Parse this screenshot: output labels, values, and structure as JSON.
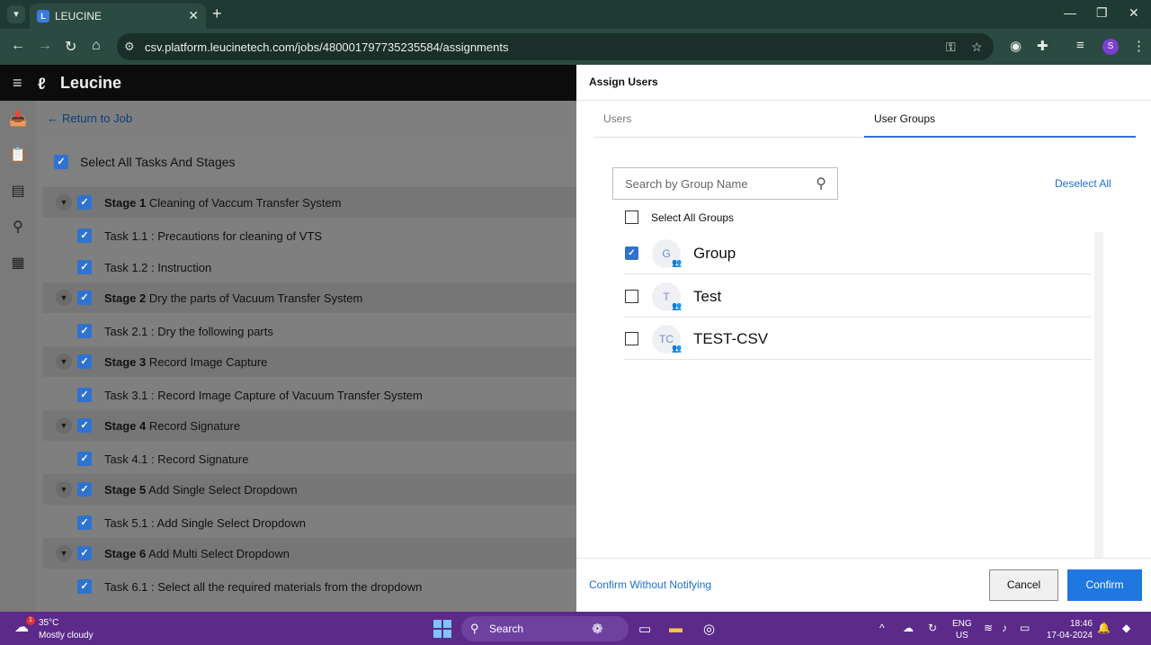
{
  "browser": {
    "tab_title": "LEUCINE",
    "tab_close": "✕",
    "tab_favicon": "L",
    "new_tab": "+",
    "url": "csv.platform.leucinetech.com/jobs/480001797735235584/assignments",
    "profile_initial": "S",
    "window": {
      "minimize": "—",
      "restore": "❐",
      "close": "✕"
    }
  },
  "app": {
    "logo_text": "Leucine",
    "back_label": "Return to Job",
    "select_all_label": "Select All Tasks And Stages",
    "tree": [
      {
        "kind": "stage",
        "number": "Stage 1",
        "name": "Cleaning of Vaccum Transfer System"
      },
      {
        "kind": "task",
        "label": "Task 1.1 : Precautions for cleaning of VTS"
      },
      {
        "kind": "task",
        "label": "Task 1.2 : Instruction"
      },
      {
        "kind": "stage",
        "number": "Stage 2",
        "name": "Dry the parts of Vacuum Transfer System"
      },
      {
        "kind": "task",
        "label": "Task 2.1 : Dry the following parts"
      },
      {
        "kind": "stage",
        "number": "Stage 3",
        "name": "Record Image Capture"
      },
      {
        "kind": "task",
        "label": "Task 3.1 : Record Image Capture of Vacuum Transfer System"
      },
      {
        "kind": "stage",
        "number": "Stage 4",
        "name": "Record Signature"
      },
      {
        "kind": "task",
        "label": "Task 4.1 : Record Signature"
      },
      {
        "kind": "stage",
        "number": "Stage 5",
        "name": "Add Single Select Dropdown"
      },
      {
        "kind": "task",
        "label": "Task 5.1 : Add Single Select Dropdown"
      },
      {
        "kind": "stage",
        "number": "Stage 6",
        "name": "Add Multi Select Dropdown"
      },
      {
        "kind": "task",
        "label": "Task 6.1 : Select all the required materials from the dropdown"
      }
    ]
  },
  "drawer": {
    "title": "Assign Users",
    "tabs": [
      "Users",
      "User Groups"
    ],
    "active_tab": "User Groups",
    "search_placeholder": "Search by Group Name",
    "deselect_all": "Deselect All",
    "select_all_groups": "Select All Groups",
    "groups": [
      {
        "initials": "G",
        "name": "Group",
        "checked": true
      },
      {
        "initials": "T",
        "name": "Test",
        "checked": false
      },
      {
        "initials": "TC",
        "name": "TEST-CSV",
        "checked": false
      }
    ],
    "confirm_without_notifying": "Confirm Without Notifying",
    "cancel": "Cancel",
    "confirm": "Confirm"
  },
  "taskbar": {
    "weather_badge": "1",
    "temperature": "35°C",
    "weather": "Mostly cloudy",
    "search_label": "Search",
    "lang_1": "ENG",
    "lang_2": "US",
    "time": "18:46",
    "date": "17-04-2024"
  },
  "colors": {
    "accent": "#2f72d0",
    "confirm_button": "#1f77e0",
    "taskbar": "#5b2a8a",
    "browser_frame": "#2b4a41"
  }
}
